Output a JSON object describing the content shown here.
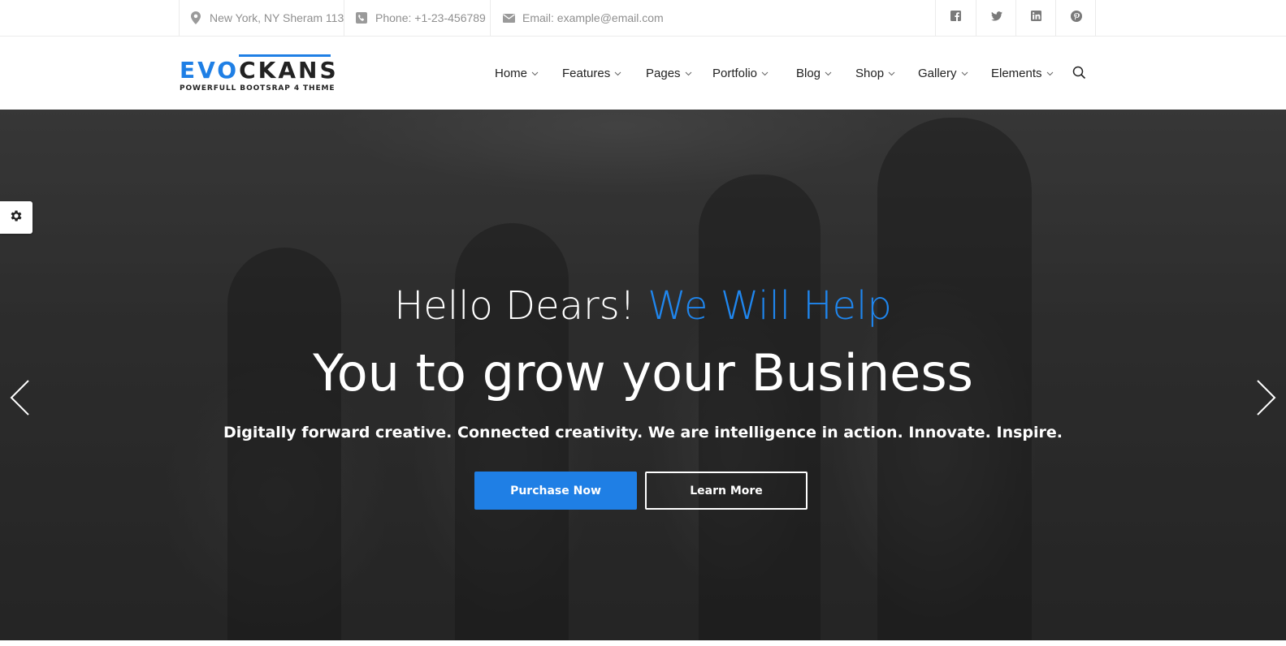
{
  "topbar": {
    "address": "New York, NY Sheram 113",
    "address_icon": "map-marker-icon",
    "phone": "Phone: +1-23-456789",
    "phone_icon": "phone-icon",
    "email": "Email: example@email.com",
    "email_icon": "envelope-icon",
    "social": [
      {
        "name": "facebook-icon"
      },
      {
        "name": "twitter-icon"
      },
      {
        "name": "linkedin-icon"
      },
      {
        "name": "pinterest-icon"
      }
    ]
  },
  "header": {
    "logo_part1": "EVO",
    "logo_part2": "CKANS",
    "logo_tagline": "POWERFULL BOOTSRAP 4 THEME",
    "nav": [
      {
        "label": "Home"
      },
      {
        "label": "Features"
      },
      {
        "label": "Pages"
      },
      {
        "label": "Portfolio"
      },
      {
        "label": "Blog"
      },
      {
        "label": "Shop"
      },
      {
        "label": "Gallery"
      },
      {
        "label": "Elements"
      }
    ],
    "search_icon": "search-icon"
  },
  "hero": {
    "line1_white": "Hello Dears! ",
    "line1_blue": "We Will Help",
    "line2": "You to grow your Business",
    "line3": "Digitally forward creative. Connected creativity. We are intelligence in action. Innovate. Inspire.",
    "primary_button": "Purchase Now",
    "secondary_button": "Learn More"
  },
  "colors": {
    "accent": "#1f7fe5",
    "text_dark": "#222222",
    "text_muted": "#8f8f8f"
  }
}
